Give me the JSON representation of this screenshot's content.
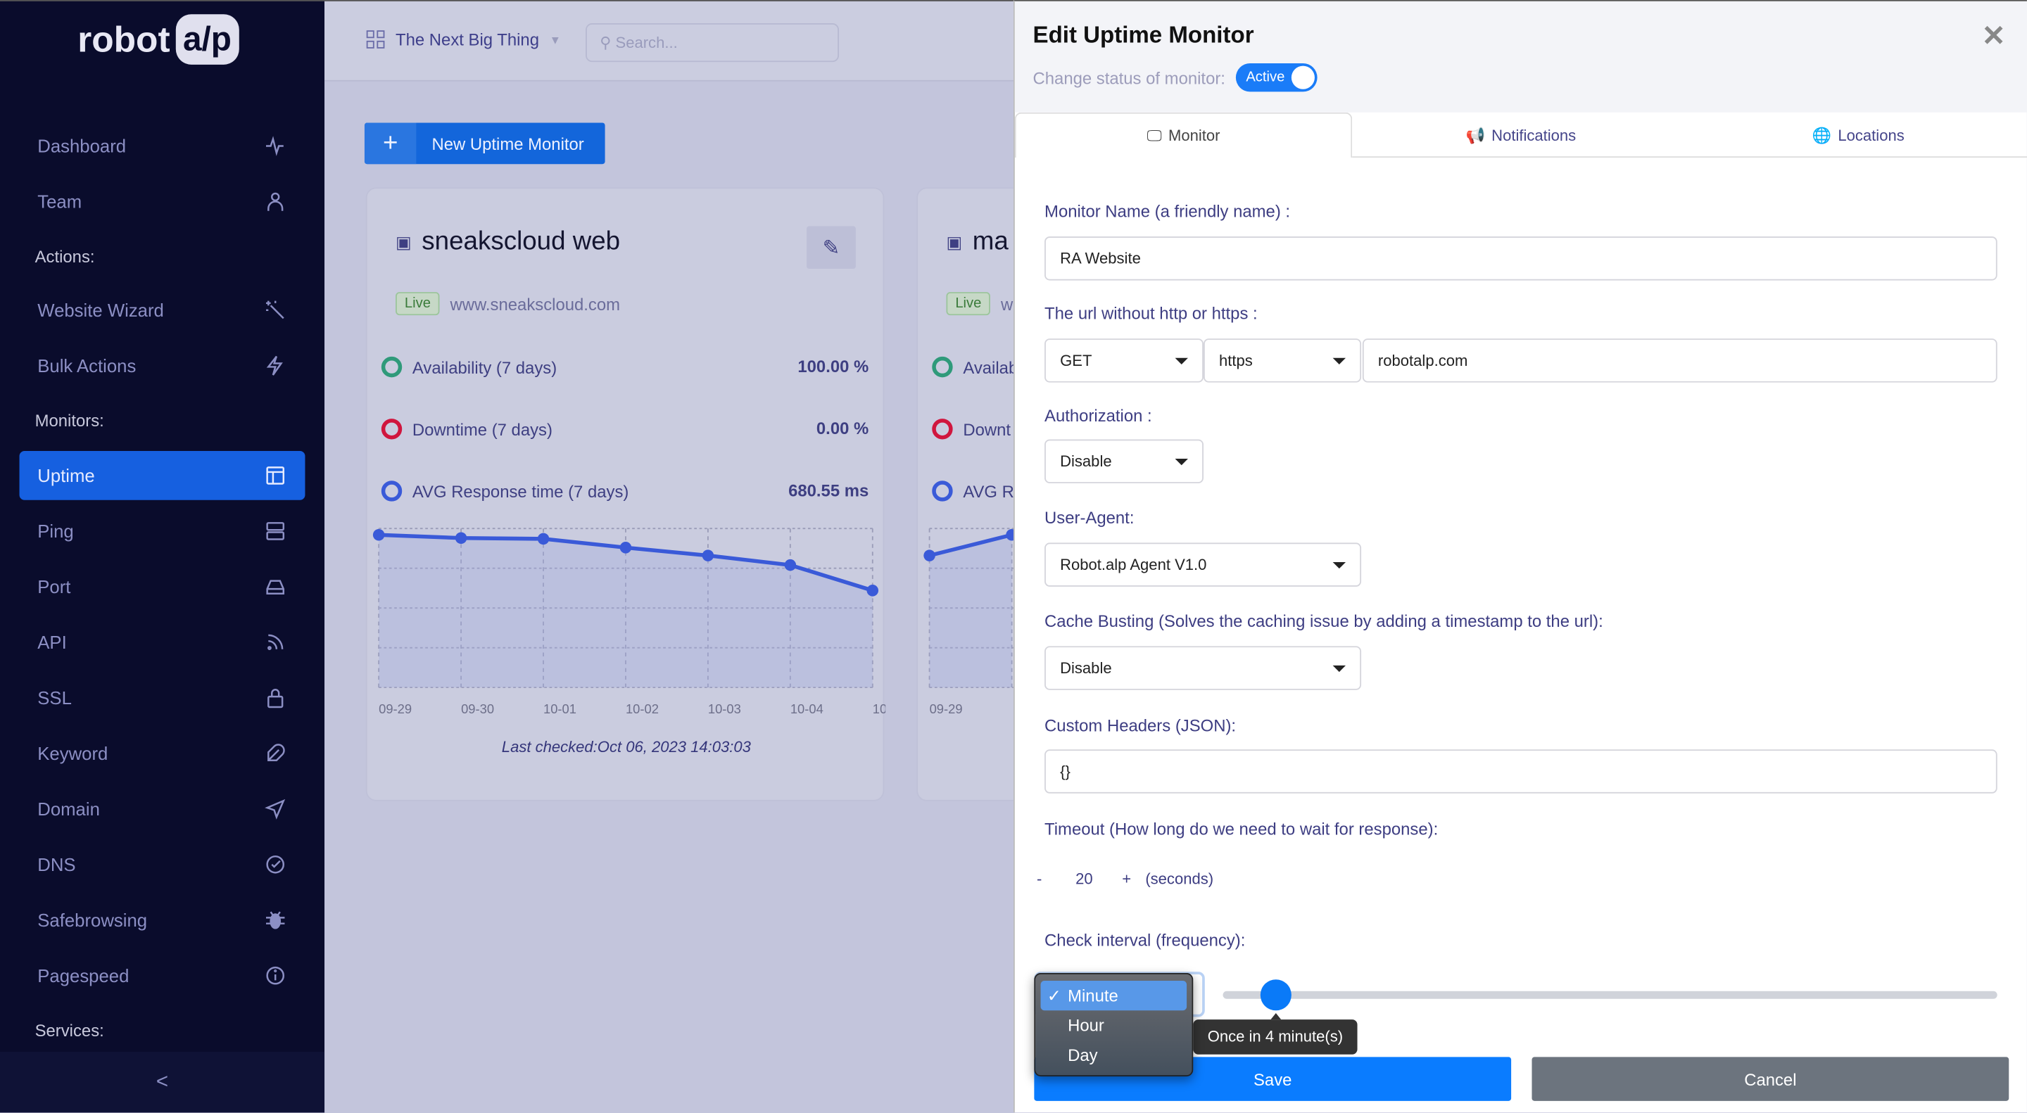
{
  "brand": {
    "logo_text": "robot",
    "logo_box": "a/p"
  },
  "sidebar": {
    "items": [
      {
        "label": "Dashboard",
        "icon": "activity-icon"
      },
      {
        "label": "Team",
        "icon": "user-icon"
      },
      {
        "label": "Website Wizard",
        "icon": "magic-wand-icon"
      },
      {
        "label": "Bulk Actions",
        "icon": "lightning-icon"
      },
      {
        "label": "Uptime",
        "icon": "layout-icon",
        "active": true
      },
      {
        "label": "Ping",
        "icon": "server-icon"
      },
      {
        "label": "Port",
        "icon": "hard-drive-icon"
      },
      {
        "label": "API",
        "icon": "rss-icon"
      },
      {
        "label": "SSL",
        "icon": "lock-icon"
      },
      {
        "label": "Keyword",
        "icon": "feather-icon"
      },
      {
        "label": "Domain",
        "icon": "send-icon"
      },
      {
        "label": "DNS",
        "icon": "check-circle-icon"
      },
      {
        "label": "Safebrowsing",
        "icon": "bug-icon"
      },
      {
        "label": "Pagespeed",
        "icon": "info-icon"
      }
    ],
    "headers": {
      "actions": "Actions:",
      "monitors": "Monitors:",
      "services": "Services:"
    },
    "collapse": "<"
  },
  "topbar": {
    "project": "The Next Big Thing",
    "search_placeholder": "Search..."
  },
  "main": {
    "new_button": "New Uptime Monitor",
    "new_button_icon": "+"
  },
  "cards": [
    {
      "title": "sneakscloud web",
      "status": "Live",
      "url": "www.sneakscloud.com",
      "stats": [
        {
          "label": "Availability (7 days)",
          "value": "100.00 %",
          "color": "#2f9a7a"
        },
        {
          "label": "Downtime (7 days)",
          "value": "0.00 %",
          "color": "#d0163e"
        },
        {
          "label": "AVG Response time (7 days)",
          "value": "680.55 ms",
          "color": "#3a5ad8"
        }
      ],
      "last_checked": "Last checked:Oct 06, 2023 14:03:03"
    },
    {
      "title": "ma",
      "status": "Live",
      "url": "w",
      "stats": [
        {
          "label": "Availab",
          "color": "#2f9a7a"
        },
        {
          "label": "Downt",
          "color": "#d0163e"
        },
        {
          "label": "AVG Re",
          "color": "#3a5ad8"
        }
      ]
    }
  ],
  "chart_data": [
    {
      "type": "area",
      "x": [
        "09-29",
        "09-30",
        "10-01",
        "10-02",
        "10-03",
        "10-04",
        "10"
      ],
      "values": [
        0.96,
        0.94,
        0.935,
        0.88,
        0.83,
        0.77,
        0.61
      ],
      "ylim": [
        0,
        1
      ],
      "grid": true,
      "color": "#3a5ad8"
    },
    {
      "type": "area",
      "x": [
        "09-29",
        ""
      ],
      "values": [
        0.83,
        0.96
      ],
      "ylim": [
        0,
        1
      ],
      "grid": true,
      "color": "#3a5ad8"
    }
  ],
  "panel": {
    "title": "Edit Uptime Monitor",
    "status_label": "Change status of monitor:",
    "status_toggle": "Active",
    "tabs": [
      {
        "label": "Monitor",
        "icon": "monitor-icon"
      },
      {
        "label": "Notifications",
        "icon": "megaphone-icon"
      },
      {
        "label": "Locations",
        "icon": "globe-icon"
      }
    ],
    "name_label": "Monitor Name (a friendly name) :",
    "name_value": "RA Website",
    "url_label": "The url without http or https :",
    "method": "GET",
    "protocol": "https",
    "url_value": "robotalp.com",
    "auth_label": "Authorization :",
    "auth_value": "Disable",
    "ua_label": "User-Agent:",
    "ua_value": "Robot.alp Agent V1.0",
    "cache_label": "Cache Busting (Solves the caching issue by adding a timestamp to the url):",
    "cache_value": "Disable",
    "headers_label": "Custom Headers (JSON):",
    "headers_value": "{}",
    "timeout_label": "Timeout (How long do we need to wait for response):",
    "timeout_minus": "-",
    "timeout_value": "20",
    "timeout_plus": "+",
    "timeout_unit": "(seconds)",
    "interval_label": "Check interval (frequency):",
    "interval_options": [
      "Minute",
      "Hour",
      "Day"
    ],
    "interval_selected": "Minute",
    "interval_check": "✓",
    "interval_slider_value": 4,
    "interval_tooltip": "Once in 4 minute(s)",
    "save": "Save",
    "cancel": "Cancel",
    "close": "✕"
  }
}
